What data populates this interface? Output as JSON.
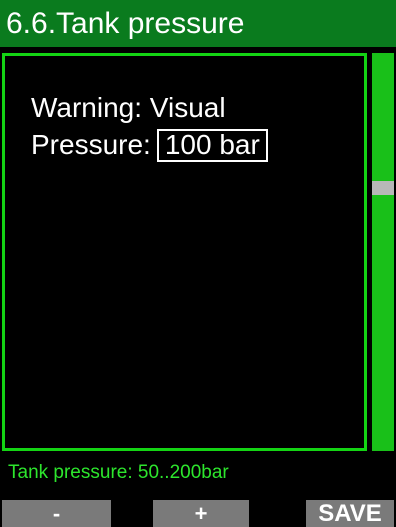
{
  "header": {
    "title": "6.6.Tank pressure"
  },
  "settings": {
    "warning_label": "Warning:",
    "warning_value": "Visual",
    "pressure_label": "Pressure:",
    "pressure_value": "100 bar"
  },
  "hint": {
    "text": "Tank pressure: 50..200bar"
  },
  "softkeys": {
    "minus": "-",
    "plus": "+",
    "save": "SAVE"
  },
  "scroll": {
    "position_fraction": 0.34
  },
  "colors": {
    "title_bar": "#0a7b1e",
    "frame_border": "#14d414",
    "scrollbar": "#19c019",
    "hint_text": "#2de52d",
    "softkey_bg": "#7a7a7a"
  }
}
